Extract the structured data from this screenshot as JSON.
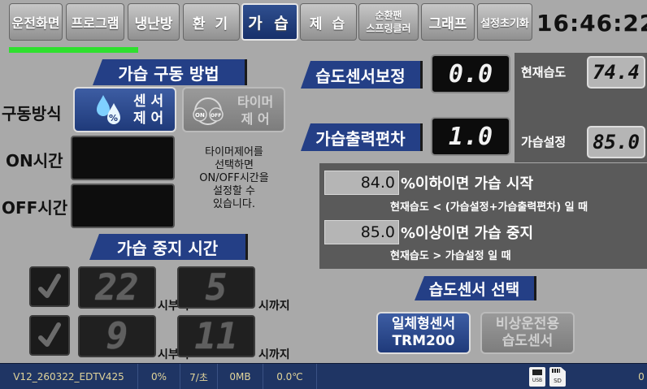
{
  "tabs": [
    {
      "label": "운전화면",
      "active": false
    },
    {
      "label": "프로그램",
      "active": false
    },
    {
      "label": "냉난방",
      "active": false
    },
    {
      "label": "환  기",
      "active": false
    },
    {
      "label": "가 습",
      "active": true
    },
    {
      "label": "제  습",
      "active": false
    },
    {
      "label_line1": "순환팬",
      "label_line2": "스프링클러",
      "active": false
    },
    {
      "label": "그래프",
      "active": false
    },
    {
      "label": "설정초기화",
      "active": false
    }
  ],
  "clock": "16:46:22",
  "progress_fraction": 0.2,
  "humid_method": {
    "title": "가습 구동 방법",
    "drive_label": "구동방식",
    "sensor_btn": {
      "line1": "센 서",
      "line2": "제 어",
      "selected": true
    },
    "timer_btn": {
      "line1": "타이머",
      "line2": "제  어",
      "selected": false
    },
    "on_time_label": "ON시간",
    "off_time_label": "OFF시간",
    "timer_note": [
      "타이머제어를",
      "선택하면",
      "ON/OFF시간을",
      "설정할 수",
      "있습니다."
    ]
  },
  "sensor_calib": {
    "label": "습도센서보정",
    "value": "0.0"
  },
  "output_offset": {
    "label": "가습출력편차",
    "value": "1.0"
  },
  "current_humidity": {
    "label": "현재습도",
    "value": "74.4"
  },
  "humid_setting": {
    "label": "가습설정",
    "value": "85.0"
  },
  "condition_start": {
    "value": "84.0",
    "main": "%이하이면 가습 시작",
    "sub": "현재습도 < (가습설정+가습출력편차) 일 때"
  },
  "condition_stop": {
    "value": "85.0",
    "main": "%이상이면 가습 중지",
    "sub": "현재습도 > 가습설정 일 때"
  },
  "stop_time": {
    "title": "가습 중지 시간",
    "rows": [
      {
        "checked": true,
        "from": "22",
        "from_suffix": "시부터",
        "to": "5",
        "to_suffix": "시까지"
      },
      {
        "checked": true,
        "from": "9",
        "from_suffix": "시부터",
        "to": "11",
        "to_suffix": "시까지"
      }
    ]
  },
  "sensor_select": {
    "title": "습도센서 선택",
    "integrated": {
      "line1": "일체형센서",
      "line2": "TRM200",
      "selected": true
    },
    "emergency": {
      "line1": "비상운전용",
      "line2": "습도센서",
      "selected": false
    }
  },
  "status_bar": {
    "version": "V12_260322_EDTV425",
    "percent": "0%",
    "rate": "7/초",
    "memory": "0MB",
    "temp": "0.0℃",
    "usb_label": "USB",
    "sd_label": "SD",
    "right_value": "0"
  },
  "colors": {
    "accent": "#243f86",
    "progress": "#2fe02f",
    "status_text": "#e1d49a"
  }
}
